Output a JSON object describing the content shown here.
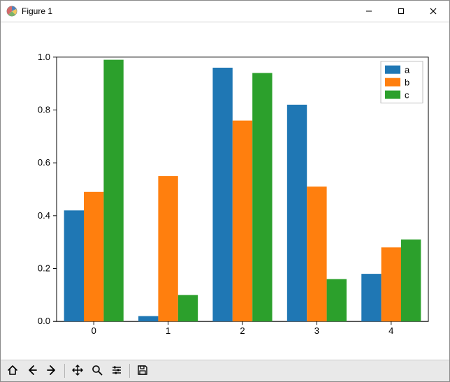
{
  "window": {
    "title": "Figure 1"
  },
  "legend": {
    "entries": [
      "a",
      "b",
      "c"
    ]
  },
  "chart_data": {
    "type": "bar",
    "categories": [
      "0",
      "1",
      "2",
      "3",
      "4"
    ],
    "series": [
      {
        "name": "a",
        "color": "#1f77b4",
        "values": [
          0.42,
          0.02,
          0.96,
          0.82,
          0.18
        ]
      },
      {
        "name": "b",
        "color": "#ff7f0e",
        "values": [
          0.49,
          0.55,
          0.76,
          0.51,
          0.28
        ]
      },
      {
        "name": "c",
        "color": "#2ca02c",
        "values": [
          0.99,
          0.1,
          0.94,
          0.16,
          0.31
        ]
      }
    ],
    "xlabel": "",
    "ylabel": "",
    "ylim": [
      0.0,
      1.0
    ],
    "yticks": [
      0.0,
      0.2,
      0.4,
      0.6,
      0.8,
      1.0
    ],
    "xticks": [
      "0",
      "1",
      "2",
      "3",
      "4"
    ]
  },
  "toolbar": {
    "home": "Home",
    "back": "Back",
    "forward": "Forward",
    "pan": "Pan",
    "zoom": "Zoom",
    "configure": "Configure subplots",
    "save": "Save"
  }
}
